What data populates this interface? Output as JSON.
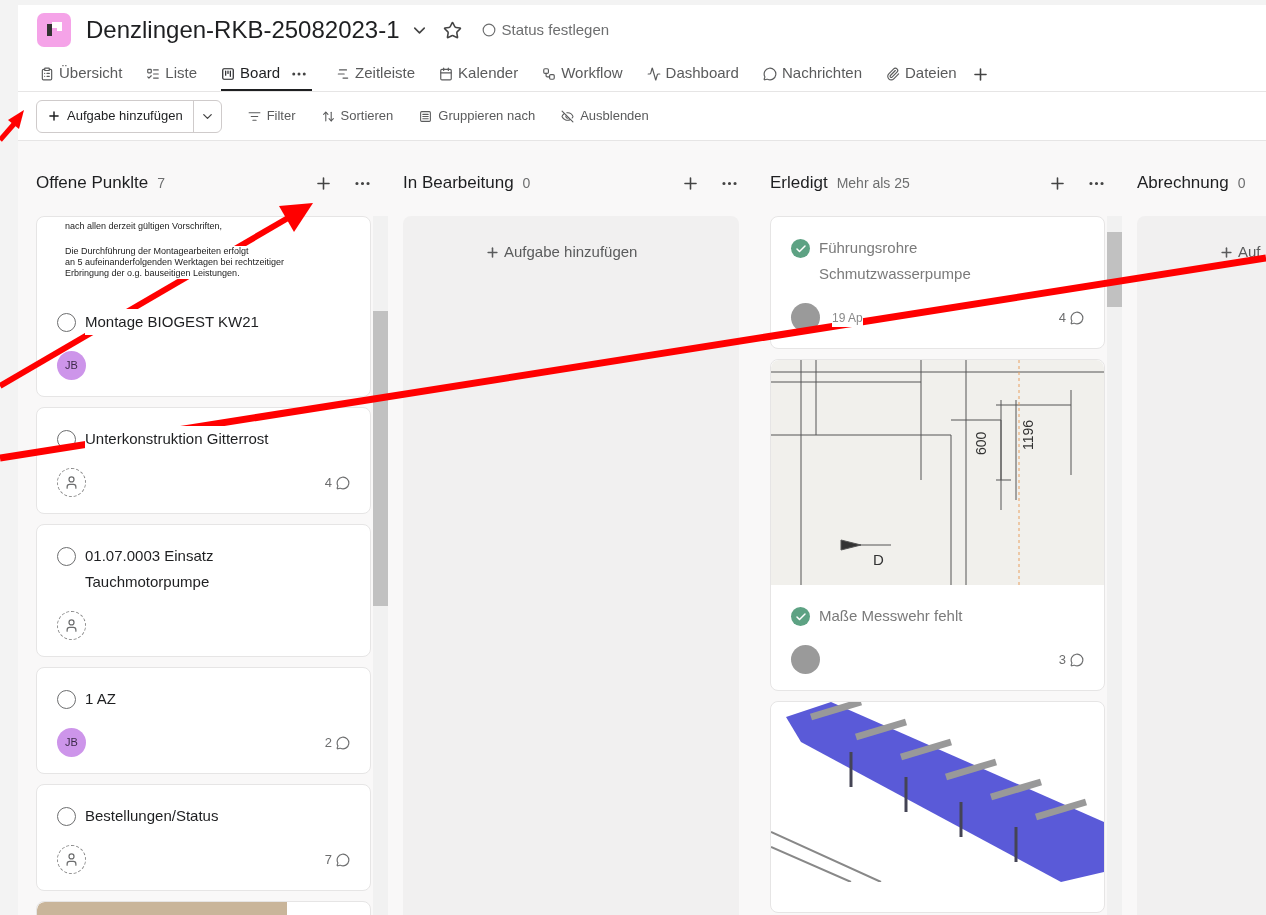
{
  "project": {
    "title": "Denzlingen-RKB-25082023-1",
    "status_label": "Status festlegen"
  },
  "tabs": [
    {
      "label": "Übersicht",
      "selected": false
    },
    {
      "label": "Liste",
      "selected": false
    },
    {
      "label": "Board",
      "selected": true
    },
    {
      "label": "Zeitleiste",
      "selected": false
    },
    {
      "label": "Kalender",
      "selected": false
    },
    {
      "label": "Workflow",
      "selected": false
    },
    {
      "label": "Dashboard",
      "selected": false
    },
    {
      "label": "Nachrichten",
      "selected": false
    },
    {
      "label": "Dateien",
      "selected": false
    }
  ],
  "toolbar": {
    "add_task": "Aufgabe hinzufügen",
    "actions": [
      "Filter",
      "Sortieren",
      "Gruppieren nach",
      "Ausblenden"
    ]
  },
  "columns": [
    {
      "title": "Offene Punklte",
      "count": "7",
      "cards": [
        {
          "attachment": {
            "kind": "document",
            "paragraphs": [
              [
                "nach allen derzeit gültigen Vorschriften,"
              ],
              [
                "Die Durchführung der Montagearbeiten erfolgt",
                "an 5 aufeinanderfolgenden Werktagen bei rechtzeitiger",
                "Erbringung der o.g. bauseitigen Leistungen."
              ]
            ]
          },
          "title": "Montage BIOGEST KW21",
          "completed": false,
          "assignee": {
            "kind": "initials",
            "initials": "JB"
          }
        },
        {
          "title": "Unterkonstruktion Gitterrost",
          "completed": false,
          "assignee": {
            "kind": "none"
          },
          "comments": "4"
        },
        {
          "title": "01.07.0003 Einsatz Tauchmotorpumpe",
          "completed": false,
          "assignee": {
            "kind": "none"
          }
        },
        {
          "title": "1 AZ",
          "completed": false,
          "assignee": {
            "kind": "initials",
            "initials": "JB"
          },
          "comments": "2"
        },
        {
          "title": "Bestellungen/Status",
          "completed": false,
          "assignee": {
            "kind": "none"
          },
          "comments": "7"
        },
        {
          "attachment": {
            "kind": "photo"
          }
        }
      ]
    },
    {
      "title": "In Bearbeitung",
      "count": "0",
      "add_task": "Aufgabe hinzufügen"
    },
    {
      "title": "Erledigt",
      "count": "Mehr als 25",
      "cards": [
        {
          "title": "Führungsrohre Schmutzwasserpumpe",
          "completed": true,
          "assignee": {
            "kind": "photo"
          },
          "due": "19 Ap",
          "comments": "4"
        },
        {
          "attachment": {
            "kind": "plan",
            "labels": [
              "600",
              "1196",
              "D"
            ]
          },
          "title": "Maße Messwehr fehlt",
          "completed": true,
          "assignee": {
            "kind": "photo"
          },
          "comments": "3"
        },
        {
          "attachment": {
            "kind": "render"
          }
        }
      ]
    },
    {
      "title": "Abrechnung",
      "count": "0",
      "add_task": "Auf"
    }
  ]
}
